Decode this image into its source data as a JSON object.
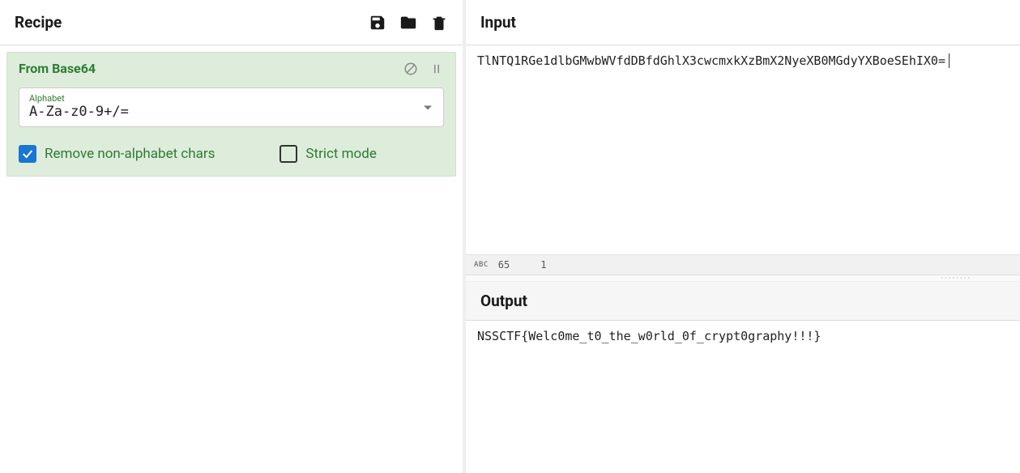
{
  "recipe": {
    "title": "Recipe",
    "operation": {
      "name": "From Base64",
      "alphabet_label": "Alphabet",
      "alphabet_value": "A-Za-z0-9+/=",
      "checkbox_remove": "Remove non-alphabet chars",
      "checkbox_strict": "Strict mode"
    }
  },
  "input": {
    "title": "Input",
    "text": "TlNTQ1RGe1dlbGMwbWVfdDBfdGhlX3cwcmxkXzBmX2NyeXB0MGdyYXBoeSEhIX0=",
    "char_count": "65",
    "line_count": "1"
  },
  "output": {
    "title": "Output",
    "text": "NSSCTF{Welc0me_t0_the_w0rld_0f_crypt0graphy!!!}"
  }
}
